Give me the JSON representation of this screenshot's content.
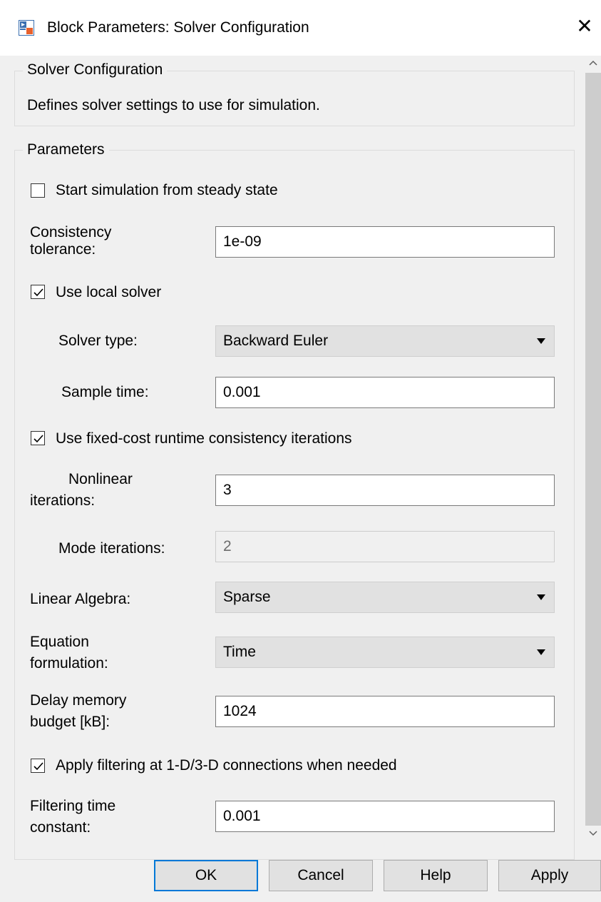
{
  "window": {
    "title": "Block Parameters: Solver Configuration",
    "close_glyph": "✕"
  },
  "description_group": {
    "legend": "Solver Configuration",
    "text": "Defines solver settings to use for simulation."
  },
  "parameters_group": {
    "legend": "Parameters",
    "start_steady_state": {
      "label": "Start simulation from steady state",
      "checked": false
    },
    "consistency_tolerance": {
      "label": "Consistency tolerance:",
      "value": "1e-09"
    },
    "use_local_solver": {
      "label": "Use local solver",
      "checked": true
    },
    "solver_type": {
      "label": "Solver type:",
      "value": "Backward Euler"
    },
    "sample_time": {
      "label": "Sample time:",
      "value": "0.001"
    },
    "fixed_cost": {
      "label": "Use fixed-cost runtime consistency iterations",
      "checked": true
    },
    "nonlinear_iterations": {
      "label_line1": "Nonlinear",
      "label_line2": "iterations:",
      "value": "3"
    },
    "mode_iterations": {
      "label": "Mode iterations:",
      "value": "2",
      "disabled": true
    },
    "linear_algebra": {
      "label": "Linear Algebra:",
      "value": "Sparse"
    },
    "equation_formulation": {
      "label_line1": "Equation",
      "label_line2": "formulation:",
      "value": "Time"
    },
    "delay_memory": {
      "label_line1": "Delay memory",
      "label_line2": "budget [kB]:",
      "value": "1024"
    },
    "apply_filtering": {
      "label": "Apply filtering at 1-D/3-D connections when needed",
      "checked": true
    },
    "filtering_time": {
      "label_line1": "Filtering time",
      "label_line2": "constant:",
      "value": "0.001"
    }
  },
  "buttons": {
    "ok": "OK",
    "cancel": "Cancel",
    "help": "Help",
    "apply": "Apply"
  },
  "icons": {
    "app": "simulink-block-icon",
    "close": "close-icon",
    "scroll_up": "chevron-up-icon",
    "scroll_down": "chevron-down-icon",
    "dropdown": "caret-down-icon",
    "check": "checkmark-icon"
  },
  "colors": {
    "accent": "#0078d7",
    "window_bg": "#f0f0f0",
    "titlebar_bg": "#ffffff"
  }
}
